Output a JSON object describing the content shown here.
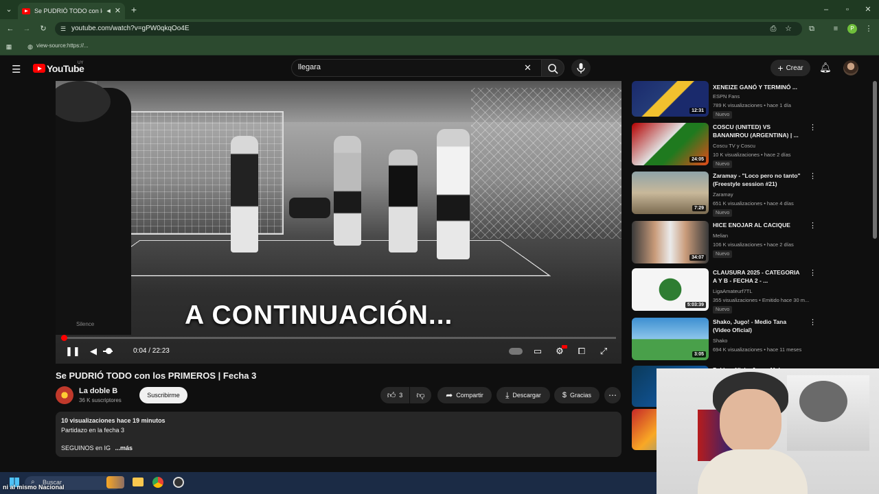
{
  "browser": {
    "tab_title": "Se PUDRIÓ TODO con los P",
    "url": "youtube.com/watch?v=gPW0qkqOo4E",
    "bookmark": "view-source:https://..."
  },
  "header": {
    "logo": "YouTube",
    "country": "UY",
    "search_value": "llegara",
    "create_label": "Crear"
  },
  "player": {
    "caption": "A CONTINUACIÓN...",
    "time": "0:04 / 22:23",
    "watermark": "Silence",
    "progress": 0.003
  },
  "video": {
    "title": "Se PUDRIÓ TODO con los PRIMEROS | Fecha 3",
    "channel": "La doble B",
    "subscribers": "36 K suscriptores",
    "subscribe_label": "Suscribirme",
    "likes": "3",
    "share_label": "Compartir",
    "download_label": "Descargar",
    "thanks_label": "Gracias",
    "desc_meta": "10 visualizaciones  hace 19 minutos",
    "desc_line1": "Partidazo en la fecha 3",
    "desc_line2": "SEGUINOS en IG",
    "more_label": "...más"
  },
  "recommendations": [
    {
      "title": "XENEIZE GANÓ Y TERMINÓ ...",
      "channel": "ESPN Fans",
      "meta": "789 K visualizaciones • hace 1 día",
      "badge": "Nuevo",
      "duration": "12:31"
    },
    {
      "title": "COSCU (UNITED) VS BANANIROU (ARGENTINA) | ...",
      "channel": "Coscu TV y Coscu",
      "meta": "10 K visualizaciones • hace 2 días",
      "badge": "Nuevo",
      "duration": "24:05"
    },
    {
      "title": "Zaramay - \"Loco pero no tanto\" (Freestyle session #21)",
      "channel": "Zaramay",
      "meta": "651 K visualizaciones • hace 4 días",
      "badge": "Nuevo",
      "duration": "7:29"
    },
    {
      "title": "HICE ENOJAR AL CACIQUE",
      "channel": "Melian",
      "meta": "106 K visualizaciones • hace 2 días",
      "badge": "Nuevo",
      "duration": "34:07"
    },
    {
      "title": "CLAUSURA 2025 - CATEGORIA A Y B - FECHA 2 - ...",
      "channel": "LigaAmateurf7TL",
      "meta": "355 visualizaciones • Emitido hace 30 m...",
      "badge": "Nuevo",
      "duration": "5:03:39"
    },
    {
      "title": "Shako, Jugo! - Medio Tana (Video Oficial)",
      "channel": "Shako",
      "meta": "694 K visualizaciones • hace 11 meses",
      "badge": "",
      "duration": "3:05"
    },
    {
      "title": "Pekka - Nicky Jam x Myke",
      "channel": "",
      "meta": "",
      "badge": "",
      "duration": ""
    }
  ],
  "taskbar": {
    "search_label": "Buscar",
    "ticker": "ni al mismo Nacional"
  },
  "colors": {
    "accent": "#ff0000",
    "bg": "#0f0f0f",
    "chrome": "#2c4a2f"
  }
}
